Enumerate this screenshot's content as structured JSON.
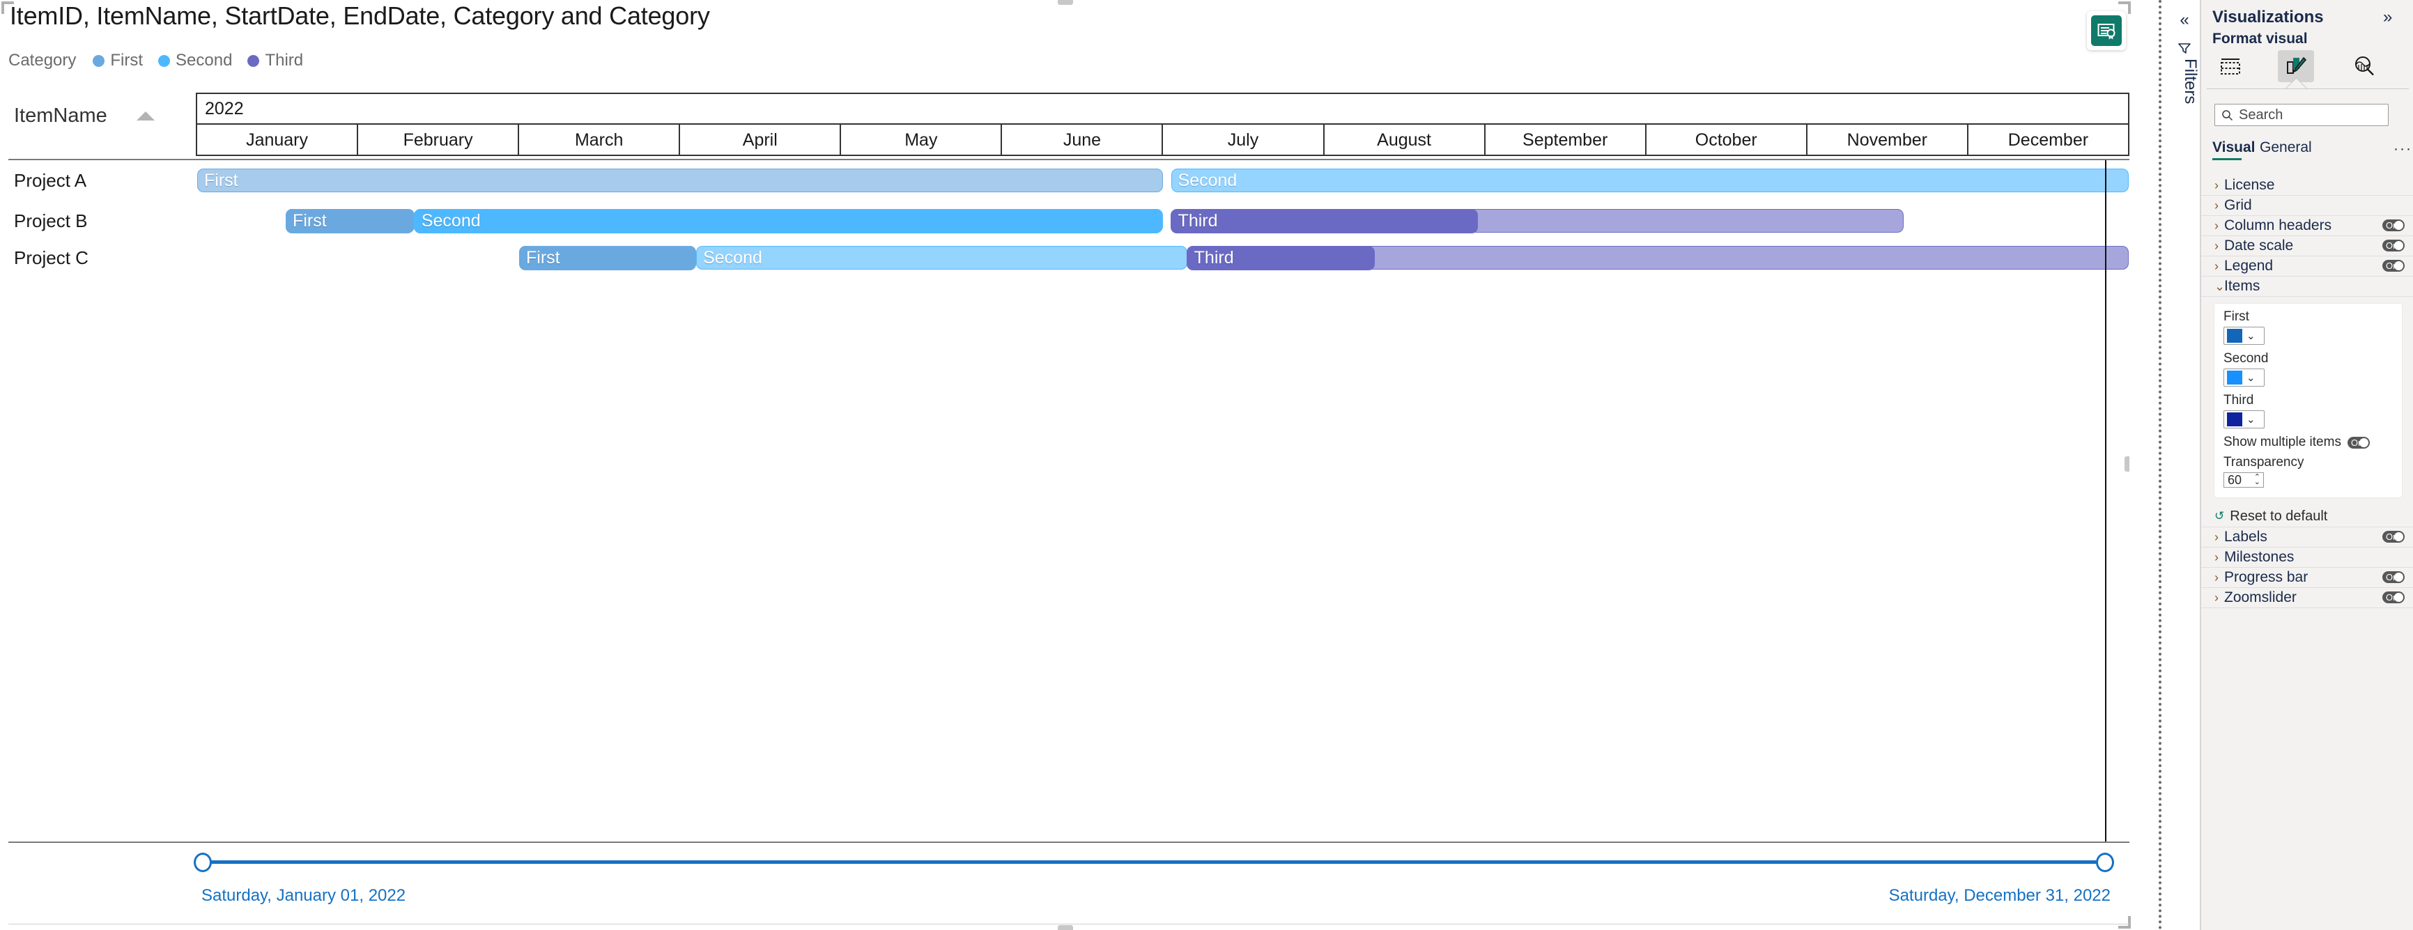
{
  "visual": {
    "title": "ItemID, ItemName, StartDate, EndDate, Category and Category",
    "certified_icon": "certified-visual-icon",
    "legend": {
      "title": "Category",
      "items": [
        {
          "label": "First",
          "color": "#6aa9e0"
        },
        {
          "label": "Second",
          "color": "#4db8ff"
        },
        {
          "label": "Third",
          "color": "#6a6ac4"
        }
      ]
    },
    "task_column": {
      "header": "ItemName",
      "sort_icon": "sort-ascending-icon"
    },
    "scale": {
      "year": "2022",
      "months": [
        "January",
        "February",
        "March",
        "April",
        "May",
        "June",
        "July",
        "August",
        "September",
        "October",
        "November",
        "December"
      ]
    },
    "zoomslider": {
      "start_label": "Saturday, January 01, 2022",
      "end_label": "Saturday, December 31, 2022",
      "track_color": "#1571c4"
    }
  },
  "chart_data": {
    "type": "bar",
    "title": "ItemID, ItemName, StartDate, EndDate, Category and Category",
    "subtype": "gantt",
    "axis_start": "2022-01-01",
    "axis_end": "2022-12-31",
    "xlabel": "2022",
    "ylabel": "ItemName",
    "categories": [
      "Project A",
      "Project B",
      "Project C"
    ],
    "legend": [
      "First",
      "Second",
      "Third"
    ],
    "legend_position": "top",
    "grid": true,
    "series": [
      {
        "name": "Project A",
        "tasks": [
          {
            "label": "First",
            "category": "First",
            "start_month": 0.0,
            "end_month": 6.0,
            "color": "#6aa9e0",
            "opacity": 0.6
          },
          {
            "label": "Second",
            "category": "Second",
            "start_month": 6.05,
            "end_month": 12.0,
            "color": "#4db8ff",
            "opacity": 0.6
          }
        ]
      },
      {
        "name": "Project B",
        "tasks": [
          {
            "label": "First",
            "category": "First",
            "start_month": 0.55,
            "end_month": 1.35,
            "color": "#6aa9e0",
            "opacity": 0.6
          },
          {
            "label": "Second",
            "category": "Second",
            "start_month": 1.35,
            "end_month": 6.0,
            "color": "#4db8ff",
            "opacity": 0.6
          },
          {
            "label": "Third",
            "category": "Third",
            "start_month": 6.05,
            "end_month": 10.6,
            "color": "#6a6ac4",
            "opacity": 0.6
          }
        ]
      },
      {
        "name": "Project C",
        "tasks": [
          {
            "label": "First",
            "category": "First",
            "start_month": 2.0,
            "end_month": 3.1,
            "color": "#6aa9e0",
            "opacity": 0.6
          },
          {
            "label": "Second",
            "category": "Second",
            "start_month": 3.1,
            "end_month": 6.15,
            "color": "#4db8ff",
            "opacity": 0.6
          },
          {
            "label": "Third",
            "category": "Third",
            "start_month": 6.15,
            "end_month": 12.0,
            "color": "#6a6ac4",
            "opacity": 0.6
          }
        ]
      }
    ],
    "progress": [
      {
        "series": "Project A",
        "task": 0,
        "fraction": 0.0
      },
      {
        "series": "Project A",
        "task": 1,
        "fraction": 0.0
      },
      {
        "series": "Project B",
        "task": 0,
        "fraction": 1.0
      },
      {
        "series": "Project B",
        "task": 1,
        "fraction": 1.0
      },
      {
        "series": "Project B",
        "task": 2,
        "fraction": 0.42
      },
      {
        "series": "Project C",
        "task": 0,
        "fraction": 1.0
      },
      {
        "series": "Project C",
        "task": 1,
        "fraction": 0.0
      },
      {
        "series": "Project C",
        "task": 2,
        "fraction": 0.2
      }
    ]
  },
  "filters_rail": {
    "collapse_icon": "chevrons-left-icon",
    "filter_icon": "filter-icon",
    "label": "Filters"
  },
  "viz_pane": {
    "title": "Visualizations",
    "expand_icon": "chevrons-right-icon",
    "subtitle": "Format visual",
    "tab_icons": [
      {
        "name": "fields-icon",
        "selected": false
      },
      {
        "name": "format-paint-icon",
        "selected": true
      },
      {
        "name": "analytics-icon",
        "selected": false
      }
    ],
    "search": {
      "placeholder": "Search",
      "icon": "search-icon"
    },
    "tabs": [
      {
        "label": "Visual",
        "active": true
      },
      {
        "label": "General",
        "active": false
      }
    ],
    "tabs_more": "···",
    "accent": "#0f7a69",
    "sections": [
      {
        "label": "License",
        "expanded": false,
        "toggle": null
      },
      {
        "label": "Grid",
        "expanded": false,
        "toggle": null
      },
      {
        "label": "Column headers",
        "expanded": false,
        "toggle": "On"
      },
      {
        "label": "Date scale",
        "expanded": false,
        "toggle": "On"
      },
      {
        "label": "Legend",
        "expanded": false,
        "toggle": "On"
      }
    ],
    "items_section": {
      "label": "Items",
      "expanded": true,
      "colors": [
        {
          "label": "First",
          "value": "#1267b8"
        },
        {
          "label": "Second",
          "value": "#1890ff"
        },
        {
          "label": "Third",
          "value": "#10239e"
        }
      ],
      "show_multiple_items": {
        "label": "Show multiple items",
        "toggle": "On"
      },
      "transparency": {
        "label": "Transparency",
        "value": "60"
      }
    },
    "reset": {
      "label": "Reset to default",
      "icon": "reset-icon"
    },
    "sections_after": [
      {
        "label": "Labels",
        "expanded": false,
        "toggle": "On"
      },
      {
        "label": "Milestones",
        "expanded": false,
        "toggle": null
      },
      {
        "label": "Progress bar",
        "expanded": false,
        "toggle": "On"
      },
      {
        "label": "Zoomslider",
        "expanded": false,
        "toggle": "On"
      }
    ]
  }
}
